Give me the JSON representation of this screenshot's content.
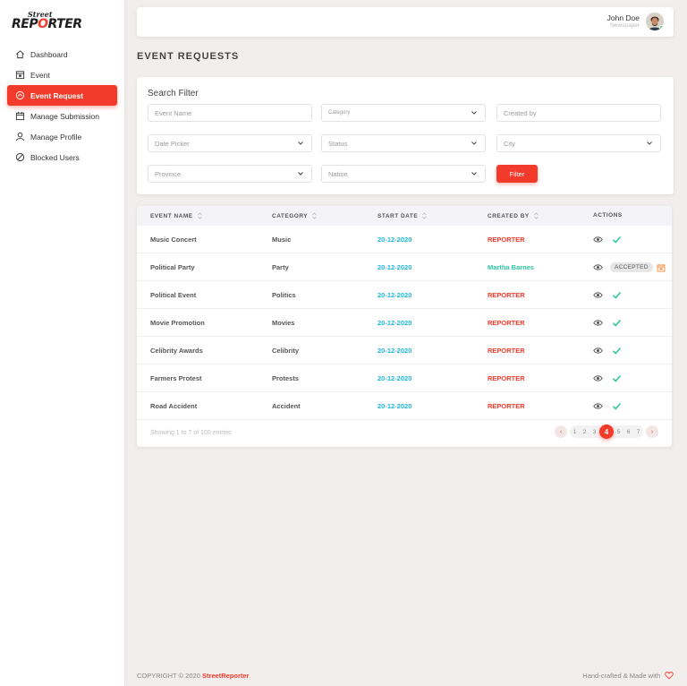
{
  "brand": {
    "line1": "Street",
    "line2a": "REP",
    "line2b": "O",
    "line2c": "RTER"
  },
  "sidebar": {
    "items": [
      {
        "label": "Dashboard",
        "icon": "home-icon"
      },
      {
        "label": "Event",
        "icon": "event-icon"
      },
      {
        "label": "Event Request",
        "icon": "event-request-icon",
        "active": true
      },
      {
        "label": "Manage Submission",
        "icon": "calendar-icon"
      },
      {
        "label": "Manage Profile",
        "icon": "user-icon"
      },
      {
        "label": "Blocked Users",
        "icon": "blocked-icon"
      }
    ]
  },
  "header": {
    "user_name": "John Doe",
    "user_role": "Newspaper"
  },
  "page": {
    "title": "EVENT REQUESTS"
  },
  "filter": {
    "title": "Search Filter",
    "event_name": "Event Name",
    "category": "Category",
    "created_by": "Created by",
    "date_picker": "Date Picker",
    "status": "Status",
    "city": "City",
    "province": "Province",
    "nation": "Nation",
    "button": "Filter"
  },
  "table": {
    "headers": [
      "EVENT NAME",
      "CATEGORY",
      "START DATE",
      "CREATED BY",
      "ACTIONS"
    ],
    "rows": [
      {
        "name": "Music Concert",
        "category": "Music",
        "date": "20-12-2020",
        "by": "REPORTER",
        "status": ""
      },
      {
        "name": "Political Party",
        "category": "Party",
        "date": "20-12-2020",
        "by": "Martha Barnes",
        "status": "ACCEPTED"
      },
      {
        "name": "Political Event",
        "category": "Politics",
        "date": "20-12-2020",
        "by": "REPORTER",
        "status": ""
      },
      {
        "name": "Movie Promotion",
        "category": "Movies",
        "date": "20-12-2020",
        "by": "REPORTER",
        "status": ""
      },
      {
        "name": "Celibrity Awards",
        "category": "Celibrity",
        "date": "20-12-2020",
        "by": "REPORTER",
        "status": ""
      },
      {
        "name": "Farmers Protest",
        "category": "Protests",
        "date": "20-12-2020",
        "by": "REPORTER",
        "status": ""
      },
      {
        "name": "Road Accident",
        "category": "Accident",
        "date": "20-12-2020",
        "by": "REPORTER",
        "status": ""
      }
    ],
    "entries_info": "Showing 1 to 7 of 100 entries",
    "pagination": {
      "prev": "‹",
      "next": "›",
      "pages_before": [
        "1",
        "2",
        "3"
      ],
      "current": "4",
      "pages_after": [
        "5",
        "6",
        "7"
      ]
    }
  },
  "footer": {
    "copyright": "COPYRIGHT © 2020",
    "brand": "StreetReporter",
    "crafted": "Hand-crafted & Made with"
  },
  "colors": {
    "accent": "#f23b2b",
    "date": "#1fb5d6",
    "accepted_user": "#2bc5a0",
    "check": "#2bc5a0"
  }
}
